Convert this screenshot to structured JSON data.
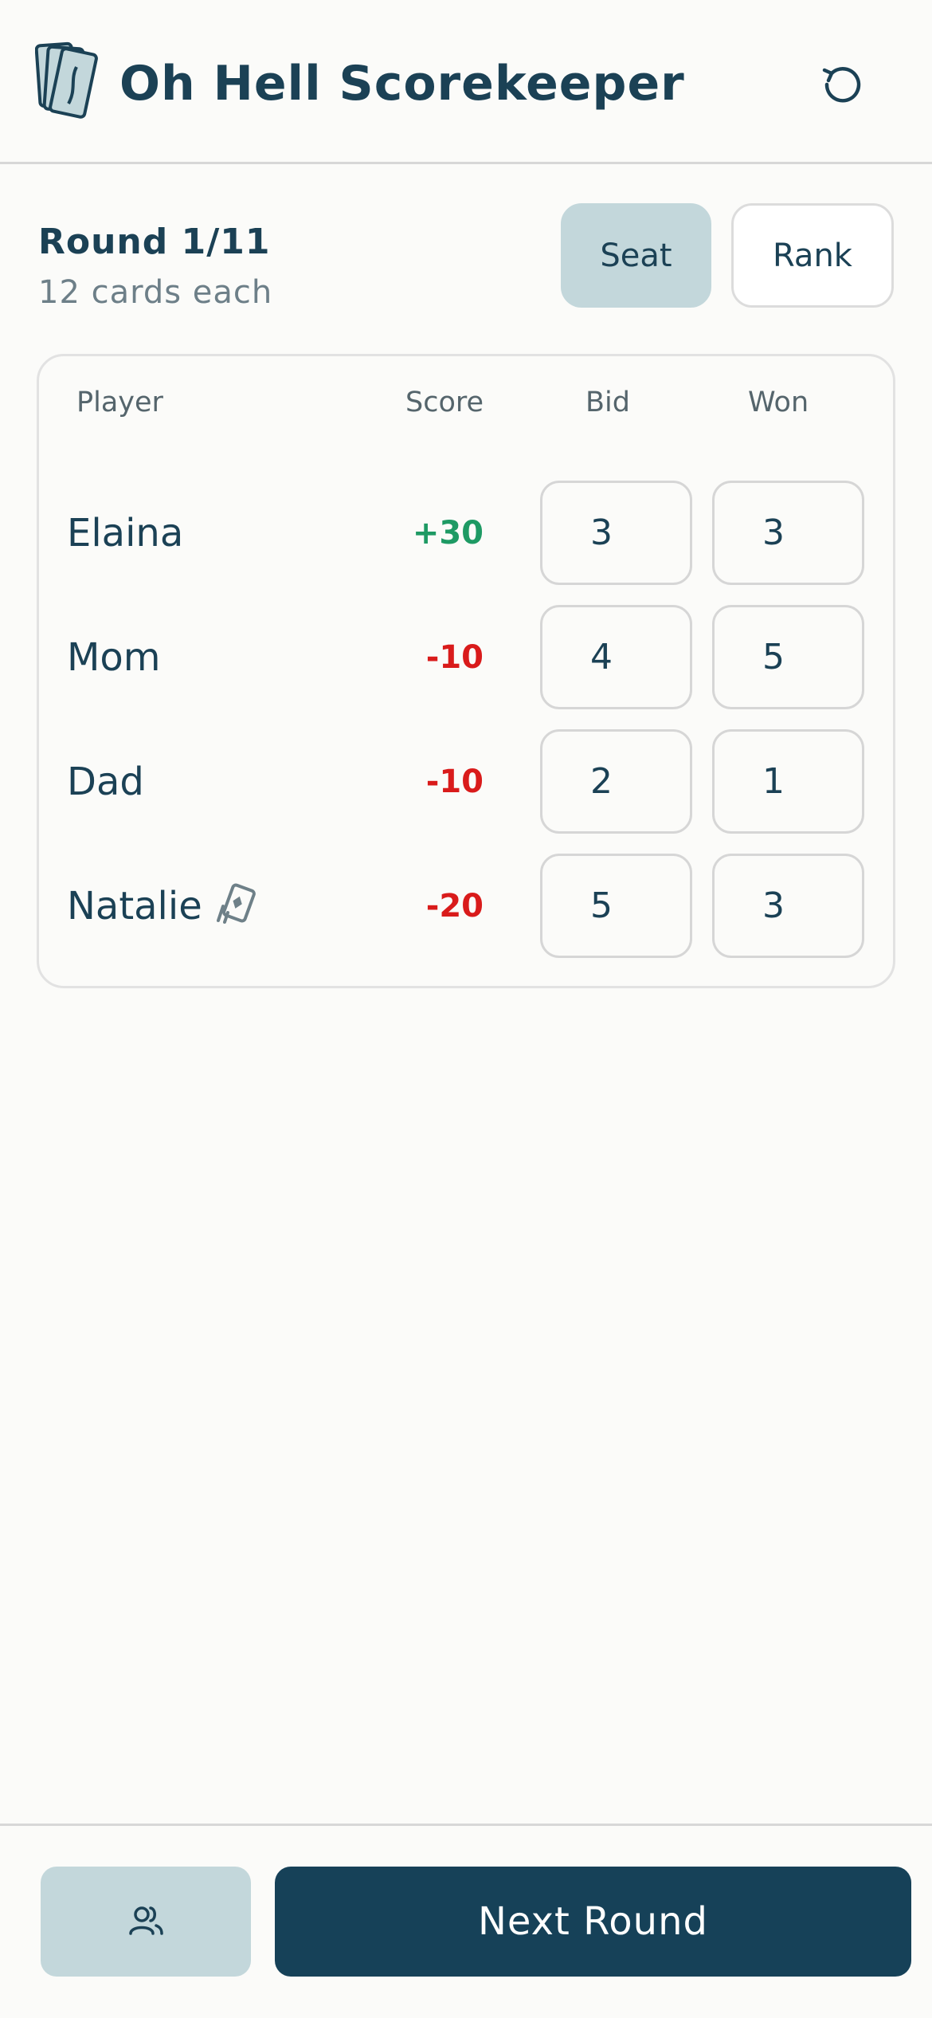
{
  "header": {
    "title": "Oh Hell Scorekeeper",
    "logo_icon": "cards-logo-icon",
    "reset_icon": "reset-icon"
  },
  "round": {
    "title": "Round 1/11",
    "subtitle": "12 cards each"
  },
  "view_toggle": {
    "seat_label": "Seat",
    "rank_label": "Rank",
    "selected": "Seat"
  },
  "table": {
    "headers": {
      "player": "Player",
      "score": "Score",
      "bid": "Bid",
      "won": "Won"
    },
    "rows": [
      {
        "name": "Elaina",
        "score": "+30",
        "bid": "3",
        "won": "3",
        "dealer": false
      },
      {
        "name": "Mom",
        "score": "-10",
        "bid": "4",
        "won": "5",
        "dealer": false
      },
      {
        "name": "Dad",
        "score": "-10",
        "bid": "2",
        "won": "1",
        "dealer": false
      },
      {
        "name": "Natalie",
        "score": "-20",
        "bid": "5",
        "won": "3",
        "dealer": true
      }
    ]
  },
  "footer": {
    "players_icon": "users-icon",
    "next_label": "Next Round"
  },
  "colors": {
    "primary": "#164158",
    "accent_light": "#c3d7db",
    "positive": "#1e9a64",
    "negative": "#d91b1b",
    "background": "#fbfbf9"
  }
}
